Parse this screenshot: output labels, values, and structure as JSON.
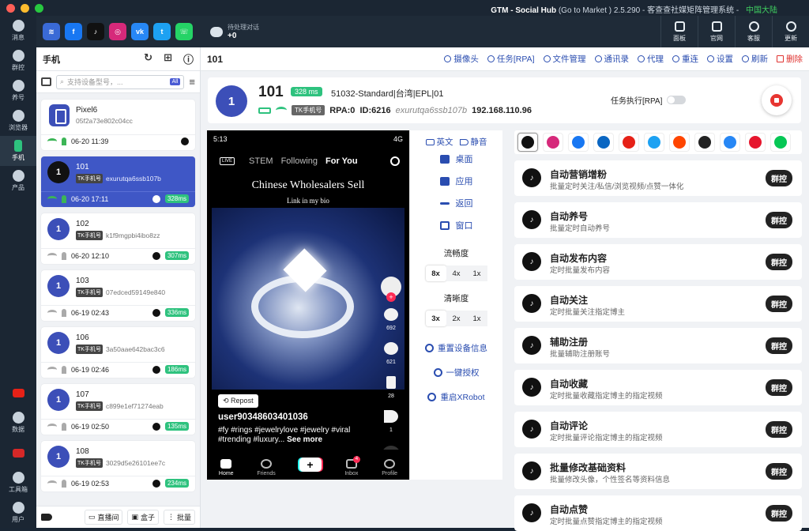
{
  "titlebar": {
    "app": "GTM - Social Hub",
    "meta": "(Go to Market ) 2.5.290 - 客查查社媒矩阵管理系统 -",
    "region": "中国大陆"
  },
  "leftnav": [
    {
      "name": "nav-messages",
      "label": "消息"
    },
    {
      "name": "nav-group",
      "label": "群控"
    },
    {
      "name": "nav-nurture",
      "label": "养号"
    },
    {
      "name": "nav-browser",
      "label": "浏览器"
    },
    {
      "name": "nav-phone",
      "label": "手机"
    },
    {
      "name": "nav-products",
      "label": "产品"
    },
    {
      "name": "nav-youtube",
      "label": ""
    },
    {
      "name": "nav-data",
      "label": "数据"
    },
    {
      "name": "nav-flag",
      "label": ""
    },
    {
      "name": "nav-toolbox",
      "label": "工具箱"
    },
    {
      "name": "nav-user",
      "label": "用户"
    }
  ],
  "topbar": {
    "platforms": [
      {
        "name": "platform-icon",
        "glyph": "≋",
        "color": "#3a6ad6"
      },
      {
        "name": "facebook-icon",
        "glyph": "f",
        "color": "#1877f2"
      },
      {
        "name": "tiktok-icon",
        "glyph": "♪",
        "color": "#111111"
      },
      {
        "name": "instagram-icon",
        "glyph": "◎",
        "color": "#d6297a"
      },
      {
        "name": "vk-icon",
        "glyph": "vk",
        "color": "#2787f5"
      },
      {
        "name": "twitter-icon",
        "glyph": "t",
        "color": "#1da1f2"
      },
      {
        "name": "whatsapp-icon",
        "glyph": "☏",
        "color": "#25d366"
      }
    ],
    "pending_label": "待处理对话",
    "pending_value": "+0",
    "buttons": [
      {
        "label": "面板"
      },
      {
        "label": "官网"
      },
      {
        "label": "客服"
      },
      {
        "label": "更新"
      }
    ]
  },
  "devices": {
    "title": "手机",
    "search_placeholder": "支持设备型号，...",
    "all_badge": "All",
    "list": [
      {
        "name": "Pixel6",
        "id": "05f2a73e802c04cc",
        "time": "06-20 11:39",
        "type": "phone",
        "avatar": "",
        "ms": "",
        "tag": ""
      },
      {
        "name": "101",
        "id": "exurutqa6ssb107b",
        "time": "06-20 17:11",
        "type": "avatar",
        "avatar": "1",
        "ms": "328ms",
        "tag": "TK手机号",
        "active": true
      },
      {
        "name": "102",
        "id": "k1f9mgpbi4ibo8zz",
        "time": "06-20 12:10",
        "type": "avatar",
        "avatar": "1",
        "ms": "307ms",
        "tag": "TK手机号"
      },
      {
        "name": "103",
        "id": "07edced59149e840",
        "time": "06-19 02:43",
        "type": "avatar",
        "avatar": "1",
        "ms": "336ms",
        "tag": "TK手机号"
      },
      {
        "name": "106",
        "id": "3a50aae642bac3c6",
        "time": "06-19 02:46",
        "type": "avatar",
        "avatar": "1",
        "ms": "186ms",
        "tag": "TK手机号"
      },
      {
        "name": "107",
        "id": "c899e1ef71274eab",
        "time": "06-19 02:50",
        "type": "avatar",
        "avatar": "1",
        "ms": "135ms",
        "tag": "TK手机号"
      },
      {
        "name": "108",
        "id": "3029d5e26101ee7c",
        "time": "06-19 02:53",
        "type": "avatar",
        "avatar": "1",
        "ms": "234ms",
        "tag": "TK手机号"
      }
    ],
    "footer": {
      "live": "直播间",
      "box": "盒子",
      "batch": "批量"
    }
  },
  "main": {
    "device_id": "101",
    "actions": [
      "摄像头",
      "任务[RPA]",
      "文件管理",
      "通讯录",
      "代理",
      "重连",
      "设置",
      "刷新",
      "删除"
    ],
    "info": {
      "avatar": "1",
      "name": "101",
      "ms": "328 ms",
      "model": "51032-Standard|台湾|EPL|01",
      "tag": "TK手机号",
      "rpa": "RPA:0",
      "idnum": "ID:6216",
      "serial": "exurutqa6ssb107b",
      "ip": "192.168.110.96",
      "rpa_task": "任务执行[RPA]"
    }
  },
  "phone": {
    "time": "5:13",
    "net": "4G",
    "tabs": [
      "STEM",
      "Following",
      "For You"
    ],
    "live": "LIVE",
    "title": "Chinese Wholesalers Sell",
    "subtitle": "Link in my bio",
    "likes": "692",
    "comments": "621",
    "saves": "28",
    "shares": "1",
    "repost": "Repost",
    "user": "user90348603401036",
    "tags": "#fy #rings #jewelrylove #jewelry #viral #trending #luxury...",
    "more": "See more",
    "nav": [
      "Home",
      "Friends",
      "+",
      "Inbox",
      "Profile"
    ],
    "inbox_badge": "4"
  },
  "controls": {
    "lang": "英文",
    "mute": "静音",
    "nav": [
      "桌面",
      "应用",
      "返回",
      "窗口"
    ],
    "fluency": "流畅度",
    "fluency_opts": [
      "8x",
      "4x",
      "1x"
    ],
    "clarity": "清晰度",
    "clarity_opts": [
      "3x",
      "2x",
      "1x"
    ],
    "reset": "重置设备信息",
    "auth": "一键授权",
    "restart": "重启XRobot"
  },
  "apps": {
    "platforms": [
      {
        "name": "tiktok-tab-icon",
        "color": "#111111"
      },
      {
        "name": "instagram-tab-icon",
        "color": "#d6297a"
      },
      {
        "name": "facebook-tab-icon",
        "color": "#1877f2"
      },
      {
        "name": "linkedin-tab-icon",
        "color": "#0a66c2"
      },
      {
        "name": "youtube-tab-icon",
        "color": "#e62117"
      },
      {
        "name": "twitter-tab-icon",
        "color": "#1da1f2"
      },
      {
        "name": "reddit-tab-icon",
        "color": "#ff4500"
      },
      {
        "name": "threads-tab-icon",
        "color": "#222222"
      },
      {
        "name": "vk-tab-icon",
        "color": "#2787f5"
      },
      {
        "name": "weibo-tab-icon",
        "color": "#e6162d"
      },
      {
        "name": "line-tab-icon",
        "color": "#06c755"
      }
    ],
    "group_label": "群控",
    "tasks": [
      {
        "title": "自动营销增粉",
        "desc": "批量定时关注/私信/浏览视频/点赞一体化"
      },
      {
        "title": "自动养号",
        "desc": "批量定时自动养号"
      },
      {
        "title": "自动发布内容",
        "desc": "定时批量发布内容"
      },
      {
        "title": "自动关注",
        "desc": "定时批量关注指定博主"
      },
      {
        "title": "辅助注册",
        "desc": "批量辅助注册账号"
      },
      {
        "title": "自动收藏",
        "desc": "定时批量收藏指定博主的指定视频"
      },
      {
        "title": "自动评论",
        "desc": "定时批量评论指定博主的指定视频"
      },
      {
        "title": "批量修改基础资料",
        "desc": "批量修改头像，个性签名等资料信息"
      },
      {
        "title": "自动点赞",
        "desc": "定时批量点赞指定博主的指定视频"
      }
    ]
  }
}
